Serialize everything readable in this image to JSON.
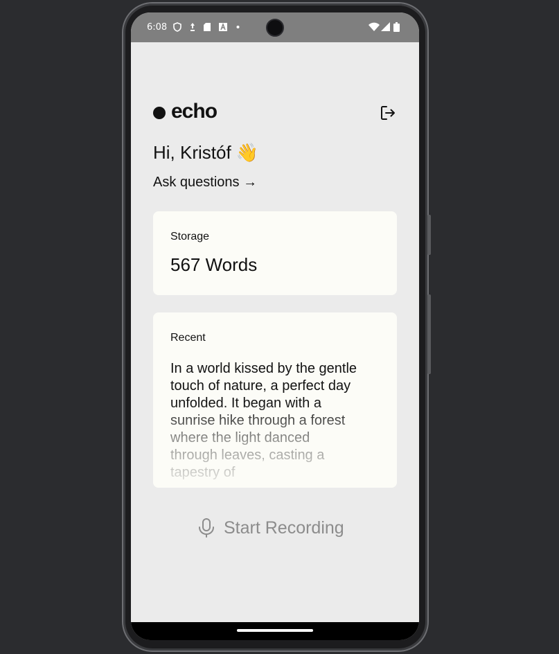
{
  "status_bar": {
    "time": "6:08",
    "icons": [
      "shield-icon",
      "hand-icon",
      "sd-card-icon",
      "a-icon",
      "dot-icon",
      "wifi-icon",
      "signal-icon",
      "battery-icon"
    ]
  },
  "app": {
    "logo": "echo",
    "greeting": "Hi, Kristóf 👋",
    "ask_link": "Ask questions →"
  },
  "storage": {
    "label": "Storage",
    "value": "567 Words"
  },
  "recent": {
    "label": "Recent",
    "text": "In a world kissed by the gentle touch of nature, a perfect day unfolded. It began with a sunrise hike through a forest where the light danced through leaves, casting a tapestry of"
  },
  "record_button": {
    "label": "Start Recording"
  },
  "colors": {
    "background": "#ebebeb",
    "card": "#fcfcf7",
    "text": "#111111",
    "muted": "#8c8c8c",
    "status_bar": "#7f7f7f"
  }
}
